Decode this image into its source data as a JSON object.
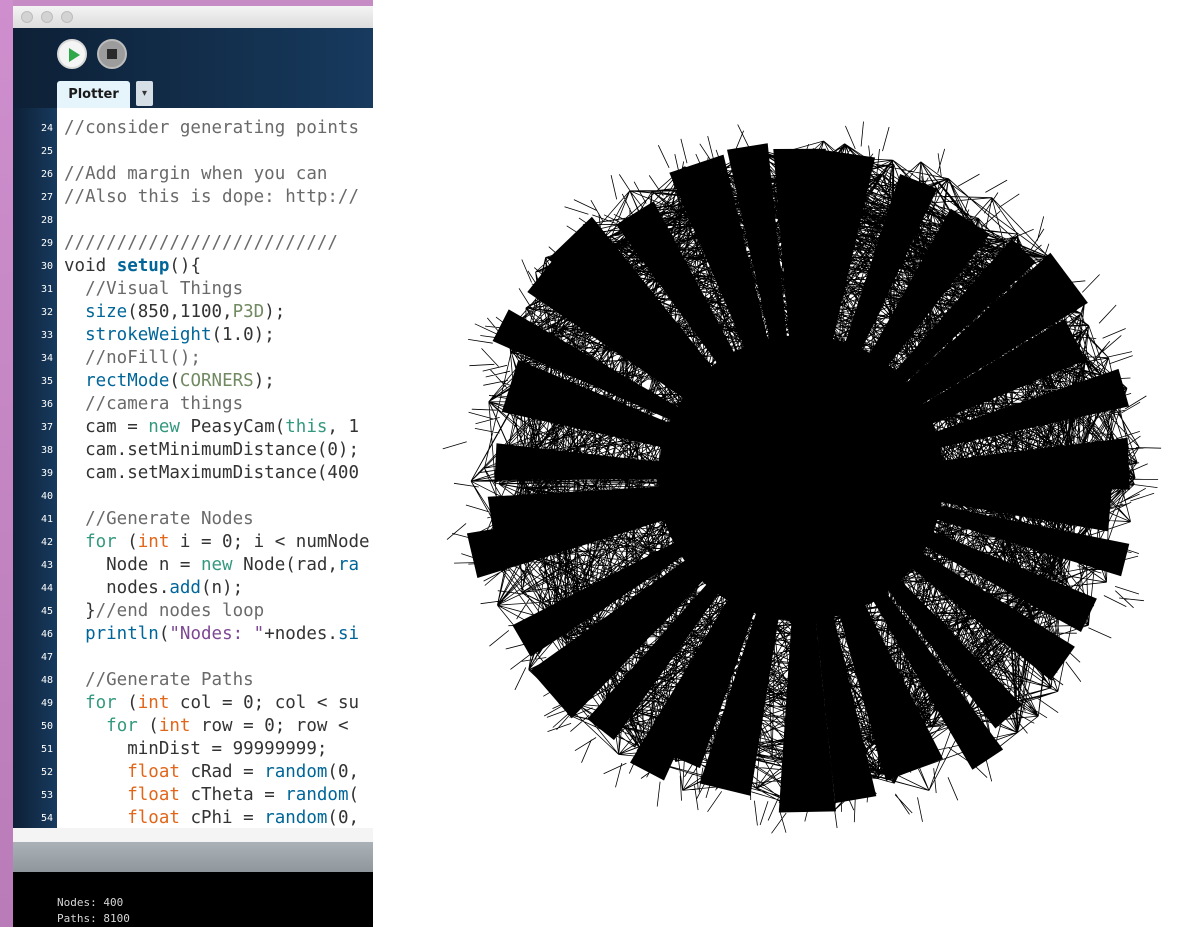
{
  "ide": {
    "title": "",
    "toolbar": {
      "run_icon": "play-icon",
      "stop_icon": "stop-icon"
    },
    "tabs": [
      {
        "label": "Plotter",
        "menu_icon": "▾"
      }
    ],
    "code": [
      {
        "n": "24",
        "parts": [
          [
            "c",
            "//consider generating points"
          ]
        ]
      },
      {
        "n": "25",
        "parts": []
      },
      {
        "n": "26",
        "parts": [
          [
            "c",
            "//Add margin when you can"
          ]
        ]
      },
      {
        "n": "27",
        "parts": [
          [
            "c",
            "//Also this is dope: http://"
          ]
        ]
      },
      {
        "n": "28",
        "parts": []
      },
      {
        "n": "29",
        "parts": [
          [
            "c",
            "//////////////////////////"
          ]
        ]
      },
      {
        "n": "30",
        "parts": [
          [
            "p",
            "void "
          ],
          [
            "bb",
            "setup"
          ],
          [
            "p",
            "(){"
          ]
        ]
      },
      {
        "n": "31",
        "parts": [
          [
            "p",
            "  "
          ],
          [
            "c",
            "//Visual Things"
          ]
        ]
      },
      {
        "n": "32",
        "parts": [
          [
            "p",
            "  "
          ],
          [
            "b",
            "size"
          ],
          [
            "p",
            "(850,1100,"
          ],
          [
            "g",
            "P3D"
          ],
          [
            "p",
            ");"
          ]
        ]
      },
      {
        "n": "33",
        "parts": [
          [
            "p",
            "  "
          ],
          [
            "b",
            "strokeWeight"
          ],
          [
            "p",
            "(1.0);"
          ]
        ]
      },
      {
        "n": "34",
        "parts": [
          [
            "p",
            "  "
          ],
          [
            "c",
            "//noFill();"
          ]
        ]
      },
      {
        "n": "35",
        "parts": [
          [
            "p",
            "  "
          ],
          [
            "b",
            "rectMode"
          ],
          [
            "p",
            "("
          ],
          [
            "g",
            "CORNERS"
          ],
          [
            "p",
            ");"
          ]
        ]
      },
      {
        "n": "36",
        "parts": [
          [
            "p",
            "  "
          ],
          [
            "c",
            "//camera things"
          ]
        ]
      },
      {
        "n": "37",
        "parts": [
          [
            "p",
            "  cam = "
          ],
          [
            "k",
            "new"
          ],
          [
            "p",
            " PeasyCam("
          ],
          [
            "k",
            "this"
          ],
          [
            "p",
            ", 1"
          ]
        ]
      },
      {
        "n": "38",
        "parts": [
          [
            "p",
            "  cam.setMinimumDistance(0);"
          ]
        ]
      },
      {
        "n": "39",
        "parts": [
          [
            "p",
            "  cam.setMaximumDistance(400"
          ]
        ]
      },
      {
        "n": "40",
        "parts": []
      },
      {
        "n": "41",
        "parts": [
          [
            "p",
            "  "
          ],
          [
            "c",
            "//Generate Nodes"
          ]
        ]
      },
      {
        "n": "42",
        "parts": [
          [
            "p",
            "  "
          ],
          [
            "k",
            "for"
          ],
          [
            "p",
            " ("
          ],
          [
            "o",
            "int"
          ],
          [
            "p",
            " i = 0; i < numNode"
          ]
        ]
      },
      {
        "n": "43",
        "parts": [
          [
            "p",
            "    Node n = "
          ],
          [
            "k",
            "new"
          ],
          [
            "p",
            " Node(rad,"
          ],
          [
            "b",
            "ra"
          ]
        ]
      },
      {
        "n": "44",
        "parts": [
          [
            "p",
            "    nodes."
          ],
          [
            "b",
            "add"
          ],
          [
            "p",
            "(n);"
          ]
        ]
      },
      {
        "n": "45",
        "parts": [
          [
            "p",
            "  }"
          ],
          [
            "c",
            "//end nodes loop"
          ]
        ]
      },
      {
        "n": "46",
        "parts": [
          [
            "p",
            "  "
          ],
          [
            "b",
            "println"
          ],
          [
            "p",
            "("
          ],
          [
            "s",
            "\"Nodes: \""
          ],
          [
            "p",
            "+nodes."
          ],
          [
            "b",
            "si"
          ]
        ]
      },
      {
        "n": "47",
        "parts": []
      },
      {
        "n": "48",
        "parts": [
          [
            "p",
            "  "
          ],
          [
            "c",
            "//Generate Paths"
          ]
        ]
      },
      {
        "n": "49",
        "parts": [
          [
            "p",
            "  "
          ],
          [
            "k",
            "for"
          ],
          [
            "p",
            " ("
          ],
          [
            "o",
            "int"
          ],
          [
            "p",
            " col = 0; col < su"
          ]
        ]
      },
      {
        "n": "50",
        "parts": [
          [
            "p",
            "    "
          ],
          [
            "k",
            "for"
          ],
          [
            "p",
            " ("
          ],
          [
            "o",
            "int"
          ],
          [
            "p",
            " row = 0; row < "
          ]
        ]
      },
      {
        "n": "51",
        "parts": [
          [
            "p",
            "      minDist = 99999999;"
          ]
        ]
      },
      {
        "n": "52",
        "parts": [
          [
            "p",
            "      "
          ],
          [
            "o",
            "float"
          ],
          [
            "p",
            " cRad = "
          ],
          [
            "b",
            "random"
          ],
          [
            "p",
            "(0,"
          ]
        ]
      },
      {
        "n": "53",
        "parts": [
          [
            "p",
            "      "
          ],
          [
            "o",
            "float"
          ],
          [
            "p",
            " cTheta = "
          ],
          [
            "b",
            "random"
          ],
          [
            "p",
            "("
          ]
        ]
      },
      {
        "n": "54",
        "parts": [
          [
            "p",
            "      "
          ],
          [
            "o",
            "float"
          ],
          [
            "p",
            " cPhi = "
          ],
          [
            "b",
            "random"
          ],
          [
            "p",
            "(0,"
          ]
        ]
      }
    ],
    "console": {
      "line1": "Nodes: 400",
      "line2": "Paths: 8100"
    }
  },
  "sketch": {
    "stroke_color": "#000000",
    "background": "#ffffff",
    "radius": 340
  }
}
